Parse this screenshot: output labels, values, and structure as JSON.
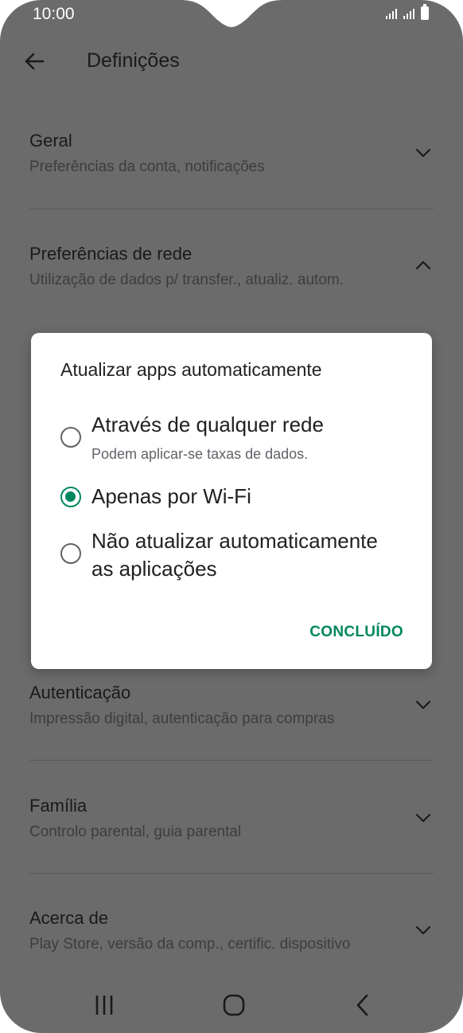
{
  "status_bar": {
    "time": "10:00"
  },
  "app_bar": {
    "title": "Definições"
  },
  "sections": [
    {
      "title": "Geral",
      "subtitle": "Preferências da conta, notificações"
    },
    {
      "title": "Preferências de rede",
      "subtitle": "Utilização de dados p/ transfer., atualiz. autom."
    },
    {
      "title": "Autenticação",
      "subtitle": "Impressão digital, autenticação para compras"
    },
    {
      "title": "Família",
      "subtitle": "Controlo parental, guia parental"
    },
    {
      "title": "Acerca de",
      "subtitle": "Play Store, versão da comp., certific. dispositivo"
    }
  ],
  "dialog": {
    "title": "Atualizar apps automaticamente",
    "options": [
      {
        "label": "Através de qualquer rede",
        "sub": "Podem aplicar-se taxas de dados.",
        "selected": false
      },
      {
        "label": "Apenas por Wi-Fi",
        "selected": true
      },
      {
        "label_line1": "Não atualizar automaticamente",
        "label_line2": "as aplicações",
        "selected": false
      }
    ],
    "done_label": "CONCLUÍDO"
  },
  "colors": {
    "accent": "#01875f",
    "scrim_background": "#6b6b6b",
    "dialog_bg": "#ffffff"
  },
  "icons": [
    "back-arrow-icon",
    "chevron-down-icon",
    "chevron-up-icon",
    "recents-icon",
    "home-icon",
    "back-nav-icon",
    "signal-icon",
    "battery-icon"
  ]
}
